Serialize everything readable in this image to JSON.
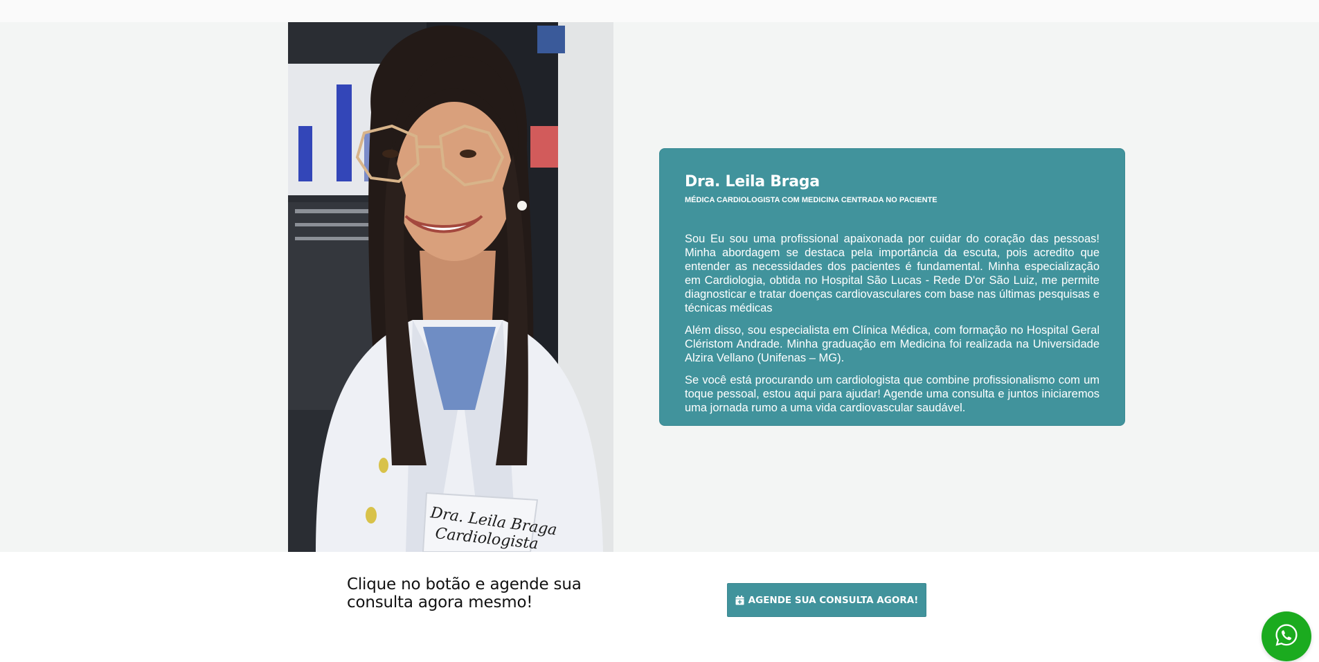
{
  "profile": {
    "name": "Dra. Leila Braga",
    "subtitle": "MÉDICA CARDIOLOGISTA COM MEDICINA CENTRADA NO PACIENTE",
    "paragraphs": [
      "Sou Eu sou uma profissional apaixonada por cuidar do coração das pessoas! Minha abordagem se destaca pela importância da escuta, pois acredito que entender as necessidades dos pacientes é fundamental. Minha especialização em Cardiologia, obtida no Hospital São Lucas - Rede D'or São Luiz, me permite diagnosticar e tratar doenças cardiovasculares com base nas últimas pesquisas e técnicas médicas",
      "Além disso, sou especialista em Clínica Médica, com formação no Hospital Geral Cléristom Andrade. Minha graduação em Medicina foi realizada na Universidade Alzira Vellano (Unifenas – MG).",
      "Se você está procurando um cardiologista que combine profissionalismo com um toque pessoal, estou aqui para ajudar! Agende uma consulta e juntos iniciaremos uma jornada rumo a uma vida cardiovascular saudável."
    ],
    "coat_embroidery": [
      "Dra. Leila Braga",
      "Cardiologista"
    ]
  },
  "cta": {
    "text": "Clique no botão e agende sua consulta agora mesmo!",
    "button_label": "AGENDE SUA CONSULTA AGORA!",
    "button_icon": "calendar-plus-icon"
  },
  "whatsapp": {
    "icon": "whatsapp-icon"
  },
  "colors": {
    "accent": "#41939c",
    "hero_bg": "#f3f5f4",
    "whatsapp": "#1bab1f"
  }
}
